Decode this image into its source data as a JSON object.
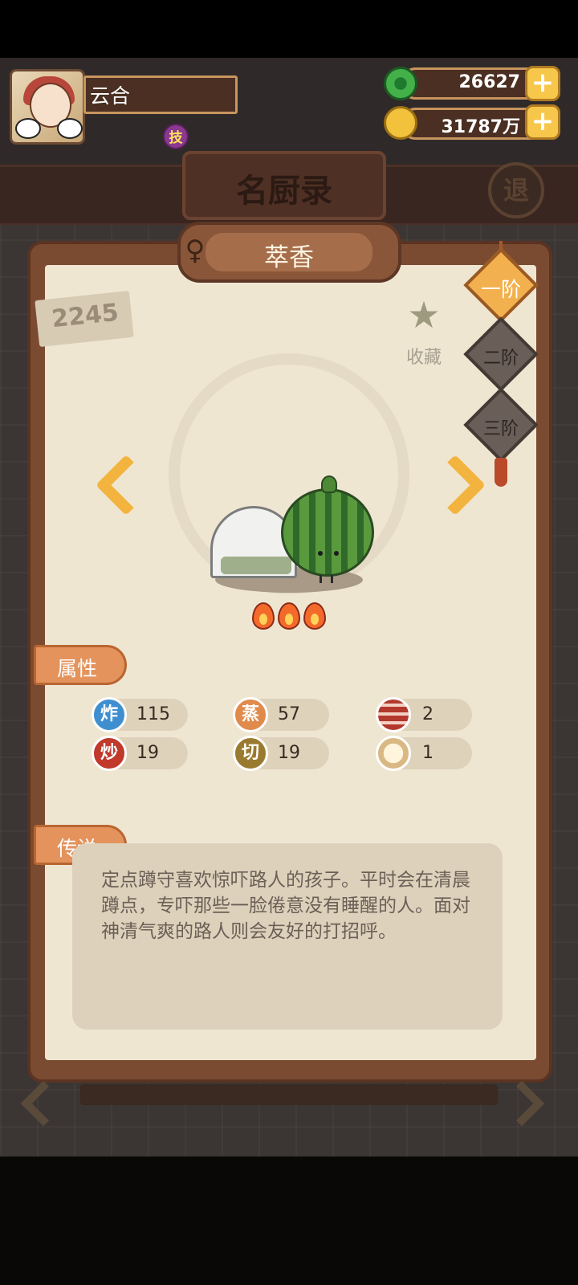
{
  "player": {
    "name": "云合",
    "skill_badge": "技"
  },
  "resources": {
    "jade": {
      "value": "26627",
      "icon": "green-jade-icon"
    },
    "coins": {
      "value": "31787万",
      "icon": "gold-coin-icon"
    }
  },
  "page": {
    "title": "名厨录",
    "exit_label": "退"
  },
  "character": {
    "gender": "♀",
    "name": "萃香",
    "number": "2245",
    "favorite_label": "收藏",
    "rarity_flames": 3
  },
  "tiers": [
    "一阶",
    "二阶",
    "三阶"
  ],
  "selected_tier": "一阶",
  "sections": {
    "attributes_title": "属性",
    "legend_title": "传说"
  },
  "stats": [
    {
      "icon_char": "炸",
      "icon_name": "fry-icon",
      "value": "115",
      "color": "#3f8fd0"
    },
    {
      "icon_char": "蒸",
      "icon_name": "steam-icon",
      "value": "57",
      "color": "#e08a4b"
    },
    {
      "icon_char": "",
      "icon_name": "meat-icon",
      "value": "2",
      "color": "#b3382d"
    },
    {
      "icon_char": "炒",
      "icon_name": "stir-fry-icon",
      "value": "19",
      "color": "#c0392b"
    },
    {
      "icon_char": "切",
      "icon_name": "cut-icon",
      "value": "19",
      "color": "#9a7a2e"
    },
    {
      "icon_char": "",
      "icon_name": "bun-icon",
      "value": "1",
      "color": "#d9b884"
    }
  ],
  "legend_text": "定点蹲守喜欢惊吓路人的孩子。平时会在清晨蹲点，专吓那些一脸倦意没有睡醒的人。面对神清气爽的路人则会友好的打招呼。",
  "colors": {
    "accent_orange": "#e4935c",
    "card_paper": "#efe6d2",
    "frame_brown": "#7b4b31"
  }
}
